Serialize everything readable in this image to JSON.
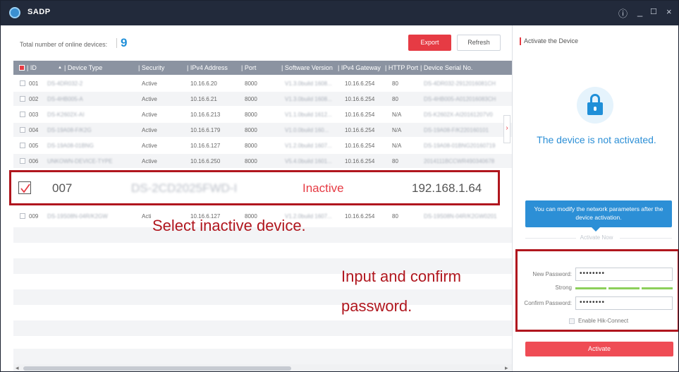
{
  "app": {
    "title": "SADP",
    "icons": {
      "logo": "sadp-logo-icon",
      "info": "info-icon",
      "minimize": "minimize-icon",
      "maximize": "maximize-icon",
      "close": "close-icon"
    }
  },
  "toolbar": {
    "online_label": "Total number of online devices:",
    "online_count": "9",
    "export_label": "Export",
    "refresh_label": "Refresh"
  },
  "table": {
    "headers": [
      "| ID",
      "| Device Type",
      "| Security",
      "| IPv4 Address",
      "| Port",
      "| Software Version",
      "| IPv4 Gateway",
      "| HTTP Port",
      "| Device Serial No."
    ],
    "sort_indicator": "▲",
    "rows": [
      {
        "id": "001",
        "type": "DS-4DR032-2",
        "security": "Active",
        "ip": "10.16.6.20",
        "port": "8000",
        "version": "V1.3.0build 1608...",
        "gateway": "10.16.6.254",
        "http": "80",
        "serial": "DS-4DR032-2912016081CH"
      },
      {
        "id": "002",
        "type": "DS-4HB005-A",
        "security": "Active",
        "ip": "10.16.6.21",
        "port": "8000",
        "version": "V1.3.0build 1608...",
        "gateway": "10.16.6.254",
        "http": "80",
        "serial": "DS-4HB005-A012016083CH"
      },
      {
        "id": "003",
        "type": "DS-K2602X-AI",
        "security": "Active",
        "ip": "10.16.6.213",
        "port": "8000",
        "version": "V1.1.0build 1612...",
        "gateway": "10.16.6.254",
        "http": "N/A",
        "serial": "DS-K2602X-AI20161207V0"
      },
      {
        "id": "004",
        "type": "DS-19A08-F/K2G",
        "security": "Active",
        "ip": "10.16.6.179",
        "port": "8000",
        "version": "V1.0.0build 160...",
        "gateway": "10.16.6.254",
        "http": "N/A",
        "serial": "DS-19A08-F/K220160101"
      },
      {
        "id": "005",
        "type": "DS-19A08-01BNG",
        "security": "Active",
        "ip": "10.16.6.127",
        "port": "8000",
        "version": "V1.2.0build 1607...",
        "gateway": "10.16.6.254",
        "http": "N/A",
        "serial": "DS-19A08-01BNG20160719"
      },
      {
        "id": "006",
        "type": "UNKOWN-DEVICE-TYPE",
        "security": "Active",
        "ip": "10.16.6.250",
        "port": "8000",
        "version": "V5.4.0build 1601...",
        "gateway": "10.16.6.254",
        "http": "80",
        "serial": "2014111BCCWR490340678"
      }
    ],
    "row_009": {
      "id": "009",
      "type": "DS-19S08N-04R/K2GW",
      "security": "Acti",
      "ip": "10.16.6.127",
      "port": "8000",
      "version": "V1.2.0build 1607...",
      "gateway": "10.16.6.254",
      "http": "80",
      "serial": "DS-19S08N-04R/K2GW0201"
    }
  },
  "selected_row": {
    "id": "007",
    "type": "DS-2CD2025FWD-I",
    "security": "Inactive",
    "ip": "192.168.1.64",
    "checkmark_icon": "checkmark-icon"
  },
  "callouts": {
    "select": "Select inactive device.",
    "password_line1": "Input and confirm",
    "password_line2": "password."
  },
  "activate_panel": {
    "title": "Activate the Device",
    "lock_icon": "lock-icon",
    "status": "The device is not activated.",
    "tip": "You can modify the network parameters after the device activation.",
    "activate_now": "Activate Now",
    "new_password_label": "New Password:",
    "new_password_value": "••••••••",
    "strength_label": "Strong",
    "confirm_password_label": "Confirm Password:",
    "confirm_password_value": "••••••••",
    "hik_connect_label": "Enable Hik-Connect",
    "activate_button": "Activate"
  },
  "colors": {
    "accent_red": "#e63b44",
    "accent_blue": "#1f8fd8",
    "titlebar": "#222a3b",
    "callout": "#b0161e"
  }
}
